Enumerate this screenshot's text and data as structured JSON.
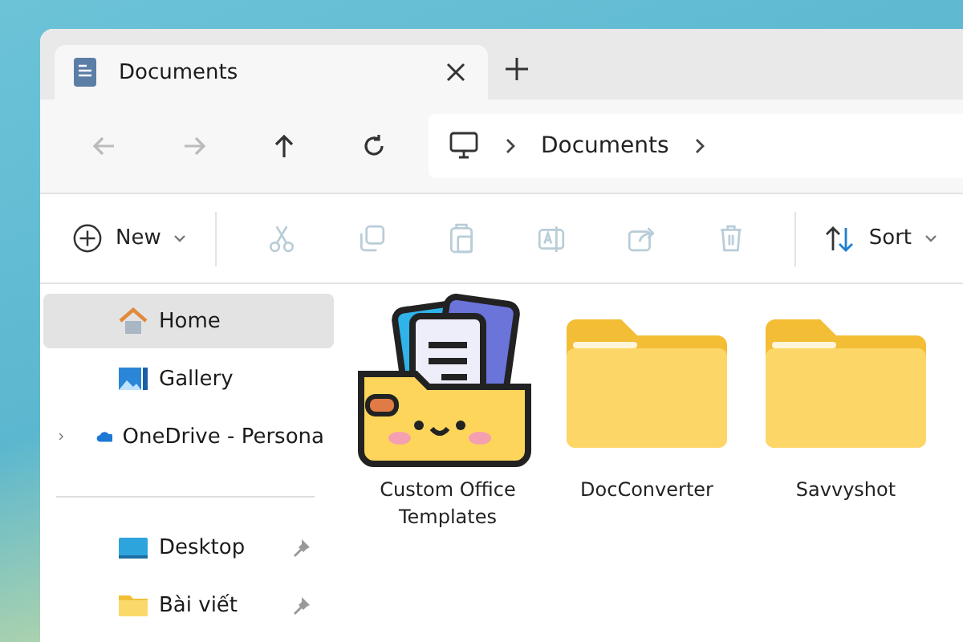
{
  "tabs": [
    {
      "label": "Documents",
      "selected": true
    }
  ],
  "nav_buttons": [
    {
      "kind": "back",
      "disabled": true
    },
    {
      "kind": "forward",
      "disabled": true
    },
    {
      "kind": "up",
      "disabled": false
    },
    {
      "kind": "refresh",
      "disabled": false
    }
  ],
  "breadcrumb": [
    "Documents"
  ],
  "toolbar": {
    "new_label": "New",
    "actions": [
      {
        "kind": "cut",
        "disabled": true
      },
      {
        "kind": "copy",
        "disabled": true
      },
      {
        "kind": "paste",
        "disabled": true
      },
      {
        "kind": "rename",
        "disabled": true
      },
      {
        "kind": "share",
        "disabled": true
      },
      {
        "kind": "delete",
        "disabled": true
      }
    ],
    "sort_label": "Sort"
  },
  "sidebar": {
    "items": [
      {
        "label": "Home",
        "kind": "home",
        "selected": true,
        "expandable": false
      },
      {
        "label": "Gallery",
        "kind": "gallery",
        "selected": false,
        "expandable": false
      },
      {
        "label": "OneDrive - Persona",
        "kind": "cloud",
        "selected": false,
        "expandable": true
      }
    ],
    "pinned": [
      {
        "label": "Desktop",
        "kind": "desktop",
        "pinned": true
      },
      {
        "label": "Bài viết",
        "kind": "folder",
        "pinned": true
      }
    ]
  },
  "files": [
    {
      "name": "Custom Office Templates",
      "kind": "custom"
    },
    {
      "name": "DocConverter",
      "kind": "folder"
    },
    {
      "name": "Savvyshot",
      "kind": "folder"
    }
  ]
}
